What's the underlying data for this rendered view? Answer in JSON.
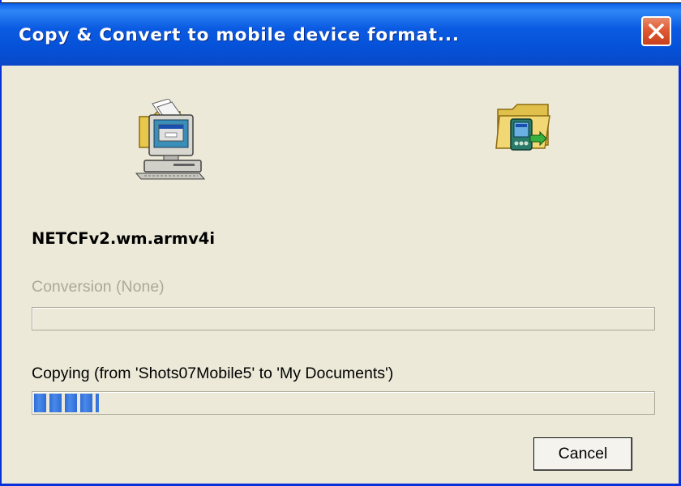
{
  "window": {
    "title": "Copy & Convert to mobile device format...",
    "close_icon": "close-icon",
    "accent_color": "#0a5fe8",
    "close_color": "#e05a34"
  },
  "icons": {
    "source": "desktop-computer-folder-icon",
    "destination": "mobile-device-folder-icon"
  },
  "file": {
    "name": "NETCFv2.wm.armv4i"
  },
  "conversion": {
    "label": "Conversion (None)",
    "progress": 0,
    "enabled": false
  },
  "copying": {
    "label": "Copying (from 'Shots07Mobile5' to 'My Documents')",
    "progress": 0.105
  },
  "buttons": {
    "cancel": "Cancel"
  }
}
